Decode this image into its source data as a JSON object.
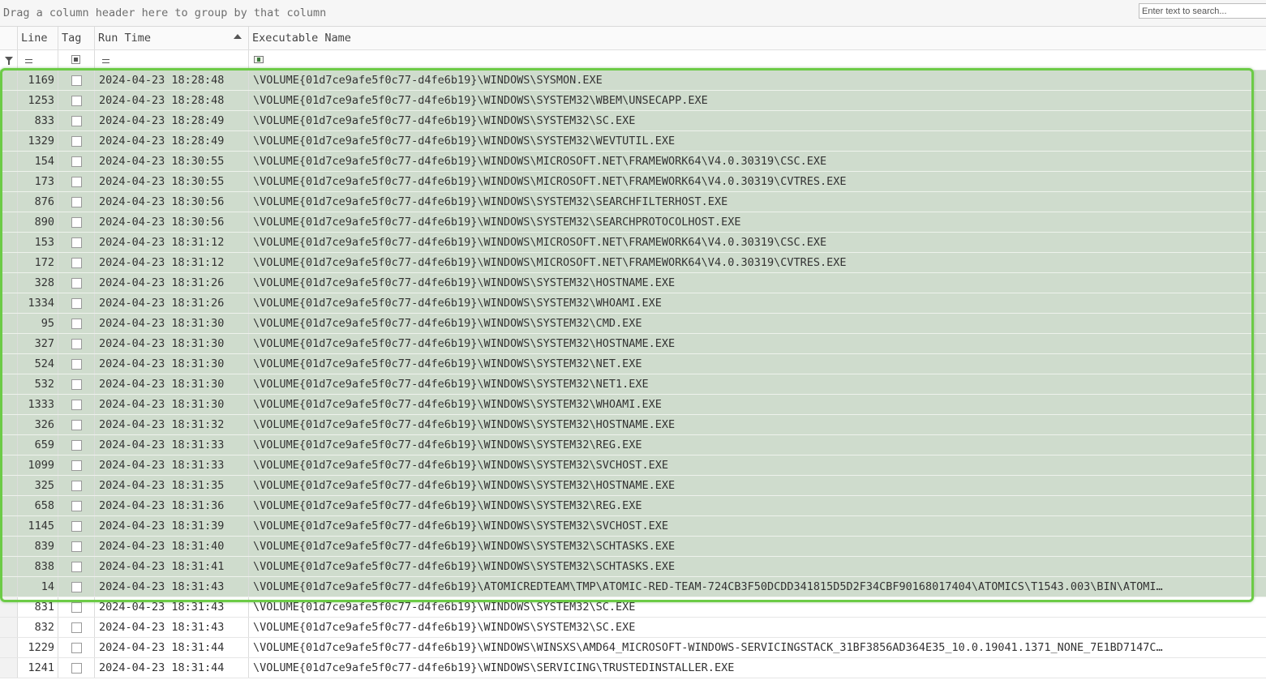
{
  "group_bar": {
    "hint": "Drag a column header here to group by that column"
  },
  "search": {
    "placeholder": "Enter text to search..."
  },
  "columns": {
    "line": "Line",
    "tag": "Tag",
    "run_time": "Run Time",
    "exe": "Executable Name"
  },
  "filter": {
    "line_op": "=",
    "run_time_op": "="
  },
  "colors": {
    "selection_bg": "#cfdccd",
    "highlight_border": "#6ccb46"
  },
  "rows": [
    {
      "line": "1169",
      "time": "2024-04-23 18:28:48",
      "exe": "\\VOLUME{01d7ce9afe5f0c77-d4fe6b19}\\WINDOWS\\SYSMON.EXE",
      "selected": true
    },
    {
      "line": "1253",
      "time": "2024-04-23 18:28:48",
      "exe": "\\VOLUME{01d7ce9afe5f0c77-d4fe6b19}\\WINDOWS\\SYSTEM32\\WBEM\\UNSECAPP.EXE",
      "selected": true
    },
    {
      "line": "833",
      "time": "2024-04-23 18:28:49",
      "exe": "\\VOLUME{01d7ce9afe5f0c77-d4fe6b19}\\WINDOWS\\SYSTEM32\\SC.EXE",
      "selected": true
    },
    {
      "line": "1329",
      "time": "2024-04-23 18:28:49",
      "exe": "\\VOLUME{01d7ce9afe5f0c77-d4fe6b19}\\WINDOWS\\SYSTEM32\\WEVTUTIL.EXE",
      "selected": true
    },
    {
      "line": "154",
      "time": "2024-04-23 18:30:55",
      "exe": "\\VOLUME{01d7ce9afe5f0c77-d4fe6b19}\\WINDOWS\\MICROSOFT.NET\\FRAMEWORK64\\V4.0.30319\\CSC.EXE",
      "selected": true
    },
    {
      "line": "173",
      "time": "2024-04-23 18:30:55",
      "exe": "\\VOLUME{01d7ce9afe5f0c77-d4fe6b19}\\WINDOWS\\MICROSOFT.NET\\FRAMEWORK64\\V4.0.30319\\CVTRES.EXE",
      "selected": true
    },
    {
      "line": "876",
      "time": "2024-04-23 18:30:56",
      "exe": "\\VOLUME{01d7ce9afe5f0c77-d4fe6b19}\\WINDOWS\\SYSTEM32\\SEARCHFILTERHOST.EXE",
      "selected": true
    },
    {
      "line": "890",
      "time": "2024-04-23 18:30:56",
      "exe": "\\VOLUME{01d7ce9afe5f0c77-d4fe6b19}\\WINDOWS\\SYSTEM32\\SEARCHPROTOCOLHOST.EXE",
      "selected": true
    },
    {
      "line": "153",
      "time": "2024-04-23 18:31:12",
      "exe": "\\VOLUME{01d7ce9afe5f0c77-d4fe6b19}\\WINDOWS\\MICROSOFT.NET\\FRAMEWORK64\\V4.0.30319\\CSC.EXE",
      "selected": true
    },
    {
      "line": "172",
      "time": "2024-04-23 18:31:12",
      "exe": "\\VOLUME{01d7ce9afe5f0c77-d4fe6b19}\\WINDOWS\\MICROSOFT.NET\\FRAMEWORK64\\V4.0.30319\\CVTRES.EXE",
      "selected": true
    },
    {
      "line": "328",
      "time": "2024-04-23 18:31:26",
      "exe": "\\VOLUME{01d7ce9afe5f0c77-d4fe6b19}\\WINDOWS\\SYSTEM32\\HOSTNAME.EXE",
      "selected": true
    },
    {
      "line": "1334",
      "time": "2024-04-23 18:31:26",
      "exe": "\\VOLUME{01d7ce9afe5f0c77-d4fe6b19}\\WINDOWS\\SYSTEM32\\WHOAMI.EXE",
      "selected": true
    },
    {
      "line": "95",
      "time": "2024-04-23 18:31:30",
      "exe": "\\VOLUME{01d7ce9afe5f0c77-d4fe6b19}\\WINDOWS\\SYSTEM32\\CMD.EXE",
      "selected": true
    },
    {
      "line": "327",
      "time": "2024-04-23 18:31:30",
      "exe": "\\VOLUME{01d7ce9afe5f0c77-d4fe6b19}\\WINDOWS\\SYSTEM32\\HOSTNAME.EXE",
      "selected": true
    },
    {
      "line": "524",
      "time": "2024-04-23 18:31:30",
      "exe": "\\VOLUME{01d7ce9afe5f0c77-d4fe6b19}\\WINDOWS\\SYSTEM32\\NET.EXE",
      "selected": true
    },
    {
      "line": "532",
      "time": "2024-04-23 18:31:30",
      "exe": "\\VOLUME{01d7ce9afe5f0c77-d4fe6b19}\\WINDOWS\\SYSTEM32\\NET1.EXE",
      "selected": true
    },
    {
      "line": "1333",
      "time": "2024-04-23 18:31:30",
      "exe": "\\VOLUME{01d7ce9afe5f0c77-d4fe6b19}\\WINDOWS\\SYSTEM32\\WHOAMI.EXE",
      "selected": true
    },
    {
      "line": "326",
      "time": "2024-04-23 18:31:32",
      "exe": "\\VOLUME{01d7ce9afe5f0c77-d4fe6b19}\\WINDOWS\\SYSTEM32\\HOSTNAME.EXE",
      "selected": true
    },
    {
      "line": "659",
      "time": "2024-04-23 18:31:33",
      "exe": "\\VOLUME{01d7ce9afe5f0c77-d4fe6b19}\\WINDOWS\\SYSTEM32\\REG.EXE",
      "selected": true
    },
    {
      "line": "1099",
      "time": "2024-04-23 18:31:33",
      "exe": "\\VOLUME{01d7ce9afe5f0c77-d4fe6b19}\\WINDOWS\\SYSTEM32\\SVCHOST.EXE",
      "selected": true
    },
    {
      "line": "325",
      "time": "2024-04-23 18:31:35",
      "exe": "\\VOLUME{01d7ce9afe5f0c77-d4fe6b19}\\WINDOWS\\SYSTEM32\\HOSTNAME.EXE",
      "selected": true
    },
    {
      "line": "658",
      "time": "2024-04-23 18:31:36",
      "exe": "\\VOLUME{01d7ce9afe5f0c77-d4fe6b19}\\WINDOWS\\SYSTEM32\\REG.EXE",
      "selected": true
    },
    {
      "line": "1145",
      "time": "2024-04-23 18:31:39",
      "exe": "\\VOLUME{01d7ce9afe5f0c77-d4fe6b19}\\WINDOWS\\SYSTEM32\\SVCHOST.EXE",
      "selected": true
    },
    {
      "line": "839",
      "time": "2024-04-23 18:31:40",
      "exe": "\\VOLUME{01d7ce9afe5f0c77-d4fe6b19}\\WINDOWS\\SYSTEM32\\SCHTASKS.EXE",
      "selected": true
    },
    {
      "line": "838",
      "time": "2024-04-23 18:31:41",
      "exe": "\\VOLUME{01d7ce9afe5f0c77-d4fe6b19}\\WINDOWS\\SYSTEM32\\SCHTASKS.EXE",
      "selected": true
    },
    {
      "line": "14",
      "time": "2024-04-23 18:31:43",
      "exe": "\\VOLUME{01d7ce9afe5f0c77-d4fe6b19}\\ATOMICREDTEAM\\TMP\\ATOMIC-RED-TEAM-724CB3F50DCDD341815D5D2F34CBF90168017404\\ATOMICS\\T1543.003\\BIN\\ATOMI…",
      "selected": true
    },
    {
      "line": "831",
      "time": "2024-04-23 18:31:43",
      "exe": "\\VOLUME{01d7ce9afe5f0c77-d4fe6b19}\\WINDOWS\\SYSTEM32\\SC.EXE",
      "selected": false
    },
    {
      "line": "832",
      "time": "2024-04-23 18:31:43",
      "exe": "\\VOLUME{01d7ce9afe5f0c77-d4fe6b19}\\WINDOWS\\SYSTEM32\\SC.EXE",
      "selected": false
    },
    {
      "line": "1229",
      "time": "2024-04-23 18:31:44",
      "exe": "\\VOLUME{01d7ce9afe5f0c77-d4fe6b19}\\WINDOWS\\WINSXS\\AMD64_MICROSOFT-WINDOWS-SERVICINGSTACK_31BF3856AD364E35_10.0.19041.1371_NONE_7E1BD7147C…",
      "selected": false
    },
    {
      "line": "1241",
      "time": "2024-04-23 18:31:44",
      "exe": "\\VOLUME{01d7ce9afe5f0c77-d4fe6b19}\\WINDOWS\\SERVICING\\TRUSTEDINSTALLER.EXE",
      "selected": false
    }
  ]
}
